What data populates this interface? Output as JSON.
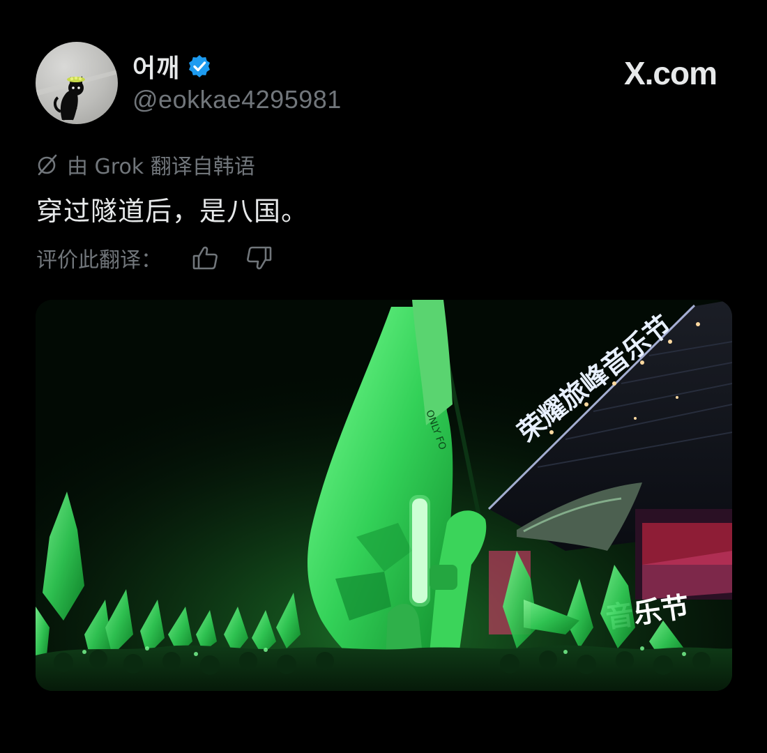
{
  "author": {
    "display_name": "어깨",
    "handle": "@eokkae4295981",
    "verified": true,
    "avatar_icon": "cat-avatar-icon"
  },
  "site": {
    "label": "X.com"
  },
  "translation": {
    "note": "由 Grok 翻译自韩语",
    "icon": "grok-icon"
  },
  "post": {
    "text": "穿过隧道后，是八国。"
  },
  "rating": {
    "label": "评价此翻译：",
    "thumbs_up_icon": "thumbs-up-icon",
    "thumbs_down_icon": "thumbs-down-icon"
  },
  "media": {
    "stage_sign": "荣耀旅峰音乐节",
    "screen_sign": "音乐节",
    "flag_text": "ONLY FO"
  },
  "colors": {
    "background": "#000000",
    "text_primary": "#e7e9ea",
    "text_secondary": "#71767b",
    "verified_blue": "#1d9bf0",
    "flag_green": "#2ee05a"
  }
}
